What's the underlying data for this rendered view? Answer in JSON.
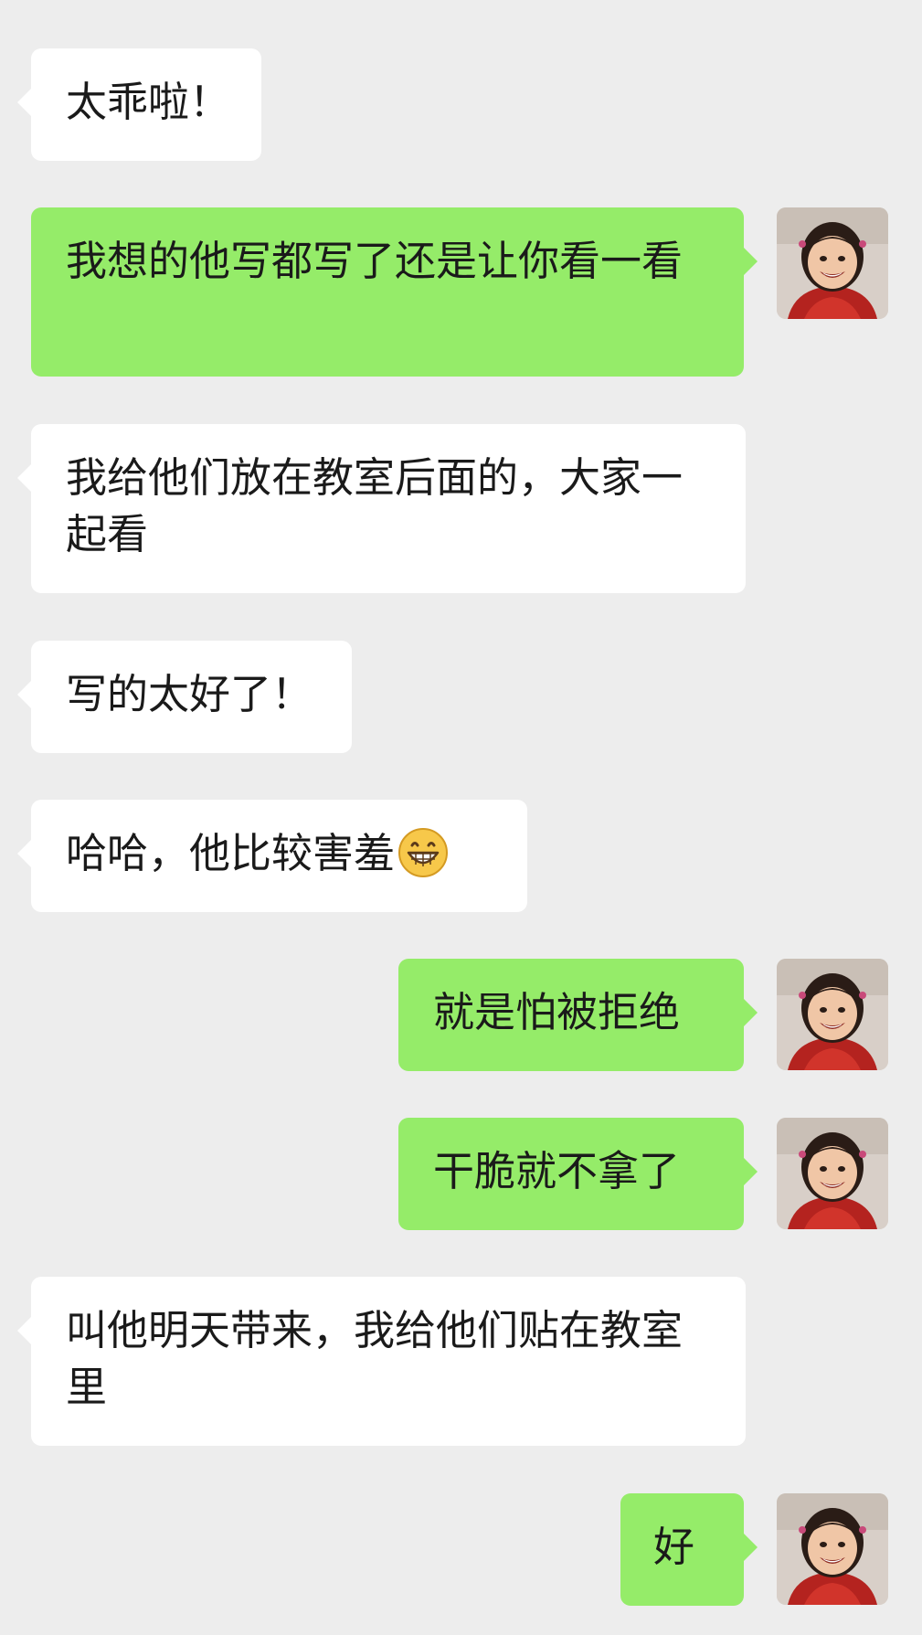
{
  "messages": [
    {
      "side": "incoming",
      "text": "太乖啦！"
    },
    {
      "side": "outgoing",
      "text": "我想的他写都写了还是让你看一看"
    },
    {
      "side": "incoming",
      "text": "我给他们放在教室后面的，大家一起看"
    },
    {
      "side": "incoming",
      "text": "写的太好了！"
    },
    {
      "side": "incoming",
      "text": "哈哈，他比较害羞",
      "emoji": "grinning-face-emoji"
    },
    {
      "side": "outgoing",
      "text": "就是怕被拒绝"
    },
    {
      "side": "outgoing",
      "text": "干脆就不拿了"
    },
    {
      "side": "incoming",
      "text": "叫他明天带来，我给他们贴在教室里"
    },
    {
      "side": "outgoing",
      "text": "好"
    }
  ],
  "colors": {
    "background": "#ededed",
    "incoming_bubble": "#ffffff",
    "outgoing_bubble": "#95ec69",
    "text": "#1a1a1a"
  },
  "icons": {
    "own_avatar": "child-photo-avatar",
    "emoji": "grinning-face-emoji"
  }
}
